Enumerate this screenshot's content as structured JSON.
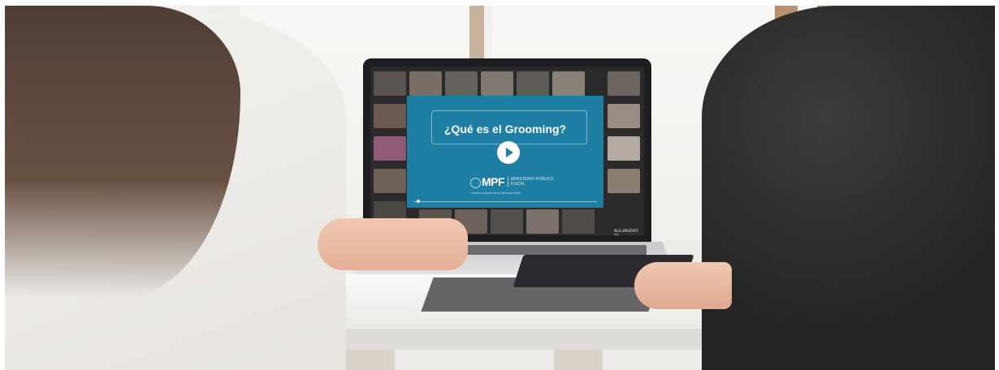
{
  "video": {
    "title": "¿Qué es el Grooming?",
    "play_icon": "play-icon",
    "logo": {
      "name": "MPF",
      "subtitle": "MINISTERIO PÚBLICO FISCAL",
      "tagline": "Ciudad Autónoma de Buenos Aires"
    },
    "tile_caption": "ALEJANDRO PA..."
  },
  "colors": {
    "card": "#1f7ea3",
    "text": "#ffffff"
  }
}
